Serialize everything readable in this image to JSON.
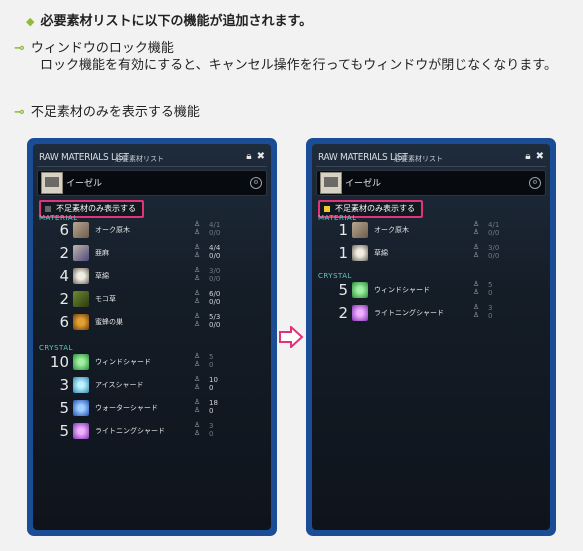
{
  "header": {
    "bullet": "◆",
    "title": "必要素材リストに以下の機能が追加されます。"
  },
  "bullets": [
    {
      "title": "ウィンドウのロック機能",
      "desc": "ロック機能を有効にすると、キャンセル操作を行ってもウィンドウが閉じなくなります。"
    },
    {
      "title": "不足素材のみを表示する機能",
      "desc": ""
    }
  ],
  "window": {
    "title": "RAW MATERIALS LIST",
    "subtitle": "必要素材リスト",
    "item_name": "イーゼル",
    "toggle_label": "不足素材のみ表示する",
    "section_material": "MATERIAL",
    "section_crystal": "CRYSTAL"
  },
  "left": {
    "materials": [
      {
        "qty": "6",
        "name": "オーク原木",
        "icon": "oak-log-icon",
        "have": "4/",
        "have2": "1",
        "need": "0/",
        "need2": "0",
        "dim": true
      },
      {
        "qty": "2",
        "name": "亜麻",
        "icon": "flax-icon",
        "have": "4/",
        "have2": "4",
        "need": "0/",
        "need2": "0",
        "dim": false
      },
      {
        "qty": "4",
        "name": "草綿",
        "icon": "cotton-icon",
        "have": "3/",
        "have2": "0",
        "need": "0/",
        "need2": "0",
        "dim": true
      },
      {
        "qty": "2",
        "name": "モコ草",
        "icon": "moko-grass-icon",
        "have": "6/",
        "have2": "0",
        "need": "0/",
        "need2": "0",
        "dim": false
      },
      {
        "qty": "6",
        "name": "蜜蜂の巣",
        "icon": "beehive-icon",
        "have": "5/",
        "have2": "3",
        "need": "0/",
        "need2": "0",
        "dim": false
      }
    ],
    "crystals": [
      {
        "qty": "10",
        "name": "ウィンドシャード",
        "icon": "wind-shard-icon",
        "have": "5",
        "need": "0",
        "dim": true
      },
      {
        "qty": "3",
        "name": "アイスシャード",
        "icon": "ice-shard-icon",
        "have": "10",
        "need": "0",
        "dim": false
      },
      {
        "qty": "5",
        "name": "ウォーターシャード",
        "icon": "water-shard-icon",
        "have": "18",
        "need": "0",
        "dim": false
      },
      {
        "qty": "5",
        "name": "ライトニングシャード",
        "icon": "lightning-shard-icon",
        "have": "3",
        "need": "0",
        "dim": true
      }
    ]
  },
  "right": {
    "materials": [
      {
        "qty": "1",
        "name": "オーク原木",
        "icon": "oak-log-icon",
        "have": "4/",
        "have2": "1",
        "need": "0/",
        "need2": "0",
        "dim": true
      },
      {
        "qty": "1",
        "name": "草綿",
        "icon": "cotton-icon",
        "have": "3/",
        "have2": "0",
        "need": "0/",
        "need2": "0",
        "dim": true
      }
    ],
    "crystals": [
      {
        "qty": "5",
        "name": "ウィンドシャード",
        "icon": "wind-shard-icon",
        "have": "5",
        "need": "0",
        "dim": true
      },
      {
        "qty": "2",
        "name": "ライトニングシャード",
        "icon": "lightning-shard-icon",
        "have": "3",
        "need": "0",
        "dim": true
      }
    ]
  },
  "colors": {
    "accent_green": "#8fba3a",
    "panel_blue": "#1b4d96",
    "toggle_border": "#e0347a",
    "section_teal": "#5cc7c2",
    "arrow_pink": "#e0347a"
  }
}
